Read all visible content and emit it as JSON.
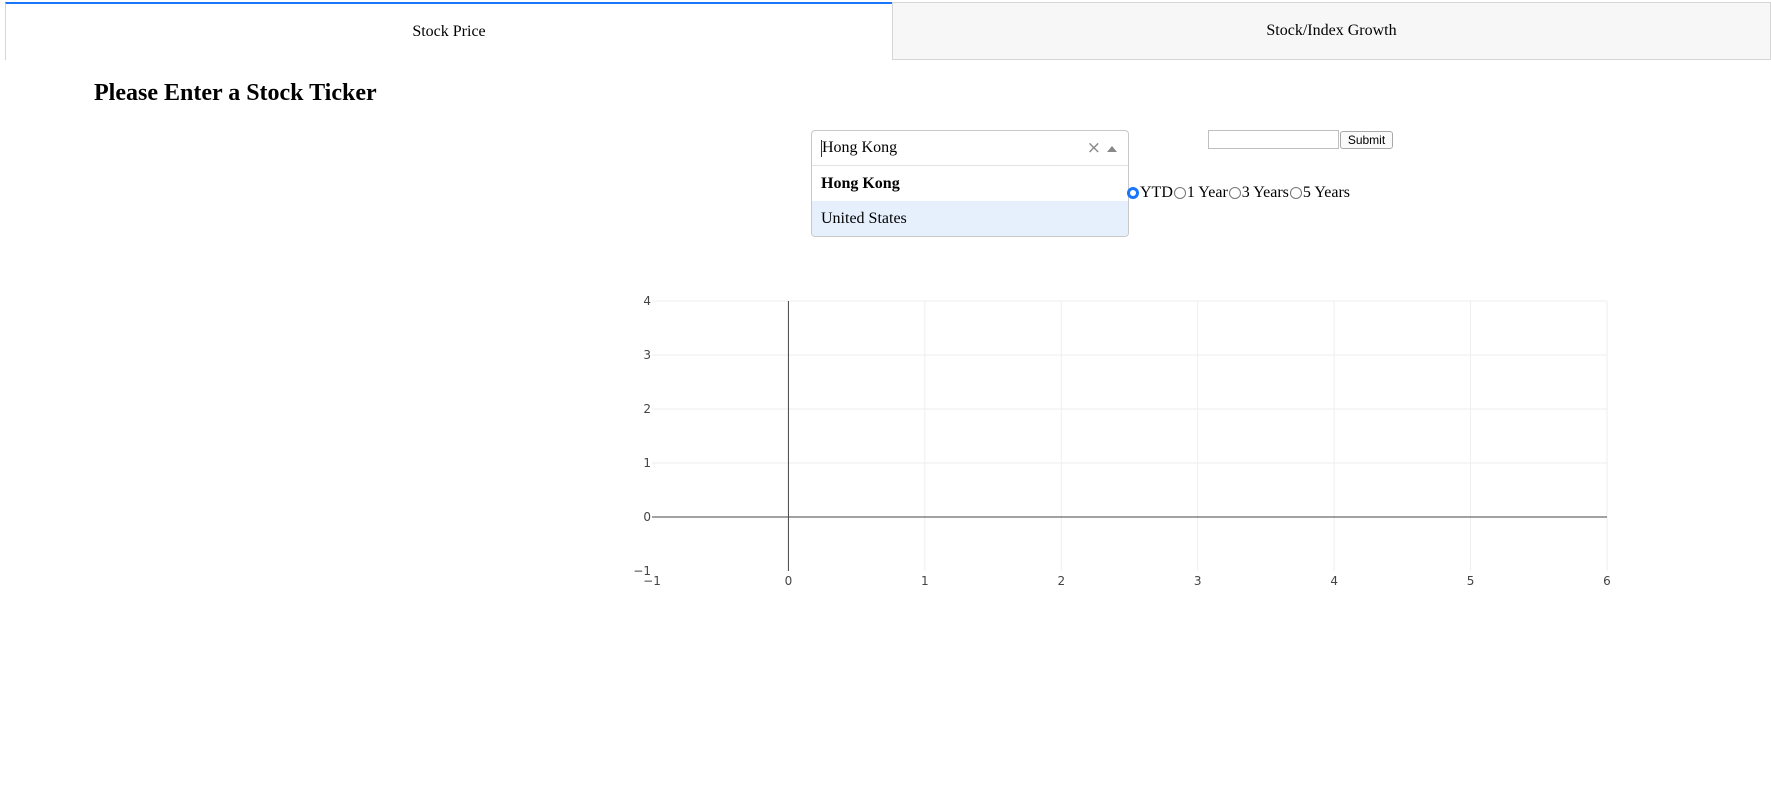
{
  "tabs": [
    {
      "label": "Stock Price",
      "active": true
    },
    {
      "label": "Stock/Index Growth",
      "active": false
    }
  ],
  "page_title": "Please Enter a Stock Ticker",
  "market_dropdown": {
    "value": "Hong Kong",
    "options": [
      {
        "label": "Hong Kong",
        "selected": true
      },
      {
        "label": "United States",
        "focused": true
      }
    ]
  },
  "ticker": {
    "value": "",
    "submit_label": "Submit"
  },
  "period_radios": {
    "selected": "YTD",
    "options": [
      "YTD",
      "1 Year",
      "3 Years",
      "5 Years"
    ]
  },
  "colors": {
    "accent": "#1975fa",
    "option_focus": "#e6f0fc",
    "grid": "#eeeeee",
    "axis": "#444444"
  },
  "chart_data": {
    "type": "line",
    "series": [],
    "xlim": [
      -1,
      6
    ],
    "ylim": [
      -1,
      4
    ],
    "x_ticks": [
      "−1",
      "0",
      "1",
      "2",
      "3",
      "4",
      "5",
      "6"
    ],
    "y_ticks": [
      "−1",
      "0",
      "1",
      "2",
      "3",
      "4"
    ],
    "grid": true,
    "title": "",
    "xlabel": "",
    "ylabel": ""
  }
}
